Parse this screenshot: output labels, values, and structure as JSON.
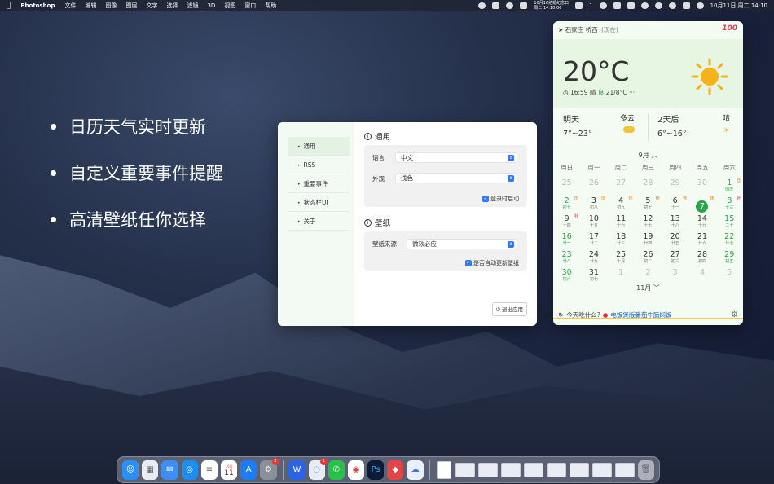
{
  "menubar": {
    "app": "Photoshop",
    "menus": [
      "文件",
      "编辑",
      "图像",
      "图层",
      "文字",
      "选择",
      "滤镜",
      "3D",
      "视图",
      "窗口",
      "帮助"
    ],
    "event_line1": "10月16结婚纪念日",
    "event_line2": "周二 14:10:06",
    "notif_count": "1",
    "datetime": "10月11日 周二  14:10"
  },
  "bullets": [
    "日历天气实时更新",
    "自定义重要事件提醒",
    "高清壁纸任你选择"
  ],
  "prefs": {
    "sidebar": [
      "通用",
      "RSS",
      "重要事件",
      "状态栏UI",
      "关于"
    ],
    "general": {
      "title": "通用",
      "language_label": "语言",
      "language_value": "中文",
      "appearance_label": "外观",
      "appearance_value": "浅色",
      "login_start": "登录时启动"
    },
    "wallpaper": {
      "title": "壁纸",
      "source_label": "壁纸来源",
      "source_value": "微软必应",
      "auto_update": "是否自动更新壁纸"
    },
    "exit_button": "退出应用"
  },
  "weather": {
    "location": "石家庄 桥西",
    "location_note": "(现在)",
    "badge": "100",
    "temp": "20°C",
    "time": "16:59",
    "condition": "晴",
    "aqi": "良",
    "range": "21/8°C",
    "forecast": [
      {
        "day": "明天",
        "cond": "多云",
        "range": "7°~23°"
      },
      {
        "day": "2天后",
        "cond": "晴",
        "range": "6°~16°"
      }
    ],
    "month_label": "9月",
    "next_month_label": "11月",
    "weekdays": [
      "周日",
      "周一",
      "周二",
      "周三",
      "周四",
      "周五",
      "周六"
    ],
    "days": [
      {
        "d": "25",
        "l": "",
        "s": "out"
      },
      {
        "d": "26",
        "l": "",
        "s": "out"
      },
      {
        "d": "27",
        "l": "",
        "s": "out"
      },
      {
        "d": "28",
        "l": "",
        "s": "out"
      },
      {
        "d": "29",
        "l": "",
        "s": "out"
      },
      {
        "d": "30",
        "l": "",
        "s": "out"
      },
      {
        "d": "1",
        "l": "国庆",
        "s": "green",
        "tag": "国",
        "tagtype": "holiday"
      },
      {
        "d": "2",
        "l": "初七",
        "s": "green",
        "tag": "国",
        "tagtype": "holiday"
      },
      {
        "d": "3",
        "l": "初八",
        "s": "",
        "tag": "国",
        "tagtype": "holiday"
      },
      {
        "d": "4",
        "l": "初九",
        "s": "",
        "tag": "休",
        "tagtype": "holiday"
      },
      {
        "d": "5",
        "l": "初十",
        "s": "",
        "tag": "休",
        "tagtype": "holiday"
      },
      {
        "d": "6",
        "l": "十一",
        "s": "",
        "tag": "休",
        "tagtype": "holiday"
      },
      {
        "d": "7",
        "l": "",
        "s": "today",
        "tag": "休",
        "tagtype": "holiday"
      },
      {
        "d": "8",
        "l": "十三",
        "s": "green",
        "tag": "补",
        "tagtype": "work"
      },
      {
        "d": "9",
        "l": "十四",
        "s": "",
        "tag": "补",
        "tagtype": "work"
      },
      {
        "d": "10",
        "l": "十五",
        "s": ""
      },
      {
        "d": "11",
        "l": "十六",
        "s": ""
      },
      {
        "d": "12",
        "l": "十七",
        "s": ""
      },
      {
        "d": "13",
        "l": "十八",
        "s": ""
      },
      {
        "d": "14",
        "l": "十九",
        "s": ""
      },
      {
        "d": "15",
        "l": "二十",
        "s": "green"
      },
      {
        "d": "16",
        "l": "廿一",
        "s": "green"
      },
      {
        "d": "17",
        "l": "廿二",
        "s": ""
      },
      {
        "d": "18",
        "l": "廿三",
        "s": ""
      },
      {
        "d": "19",
        "l": "廿四",
        "s": ""
      },
      {
        "d": "20",
        "l": "廿五",
        "s": ""
      },
      {
        "d": "21",
        "l": "廿六",
        "s": ""
      },
      {
        "d": "22",
        "l": "廿七",
        "s": "green"
      },
      {
        "d": "23",
        "l": "廿八",
        "s": "green"
      },
      {
        "d": "24",
        "l": "廿九",
        "s": ""
      },
      {
        "d": "25",
        "l": "十月",
        "s": ""
      },
      {
        "d": "26",
        "l": "初二",
        "s": ""
      },
      {
        "d": "27",
        "l": "初三",
        "s": ""
      },
      {
        "d": "28",
        "l": "初四",
        "s": ""
      },
      {
        "d": "29",
        "l": "初五",
        "s": "green"
      },
      {
        "d": "30",
        "l": "初六",
        "s": "green"
      },
      {
        "d": "31",
        "l": "初七",
        "s": ""
      },
      {
        "d": "1",
        "l": "",
        "s": "out"
      },
      {
        "d": "2",
        "l": "",
        "s": "out"
      },
      {
        "d": "3",
        "l": "",
        "s": "out"
      },
      {
        "d": "4",
        "l": "",
        "s": "out"
      },
      {
        "d": "5",
        "l": "",
        "s": "out"
      }
    ],
    "footer_text": "今天吃什么?",
    "footer_food": "电饭煲版番茄牛腩焖饭"
  },
  "dock": {
    "calendar_month": "10月",
    "calendar_day": "11",
    "settings_badge": "2",
    "messages_badge": "1"
  },
  "colors": {
    "accent_green": "#2aa54a",
    "checkbox_blue": "#3478f6"
  }
}
